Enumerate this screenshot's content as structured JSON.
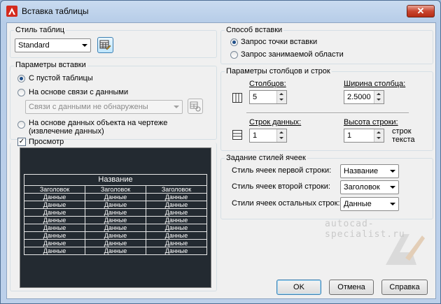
{
  "window": {
    "title": "Вставка таблицы",
    "close_glyph": "✕"
  },
  "table_style": {
    "title": "Стиль таблиц",
    "selected": "Standard"
  },
  "insert_params": {
    "title": "Параметры вставки",
    "opt_empty": "С пустой таблицы",
    "opt_data_link": "На основе связи с данными",
    "data_link_combo": "Связи с данными не обнаружены",
    "opt_object_data": "На основе данных объекта на чертеже (извлечение данных)"
  },
  "preview": {
    "label": "Просмотр",
    "checked": true,
    "title": "Название",
    "headers": [
      "Заголовок",
      "Заголовок",
      "Заголовок"
    ],
    "rows": [
      [
        "Данные",
        "Данные",
        "Данные"
      ],
      [
        "Данные",
        "Данные",
        "Данные"
      ],
      [
        "Данные",
        "Данные",
        "Данные"
      ],
      [
        "Данные",
        "Данные",
        "Данные"
      ],
      [
        "Данные",
        "Данные",
        "Данные"
      ],
      [
        "Данные",
        "Данные",
        "Данные"
      ],
      [
        "Данные",
        "Данные",
        "Данные"
      ],
      [
        "Данные",
        "Данные",
        "Данные"
      ]
    ]
  },
  "insert_method": {
    "title": "Способ вставки",
    "opt_point": "Запрос точки вставки",
    "opt_area": "Запрос занимаемой области"
  },
  "col_row_params": {
    "title": "Параметры столбцов и строк",
    "columns_label": "Столбцов:",
    "columns_value": "5",
    "col_width_label": "Ширина столбца:",
    "col_width_value": "2.5000",
    "data_rows_label": "Строк данных:",
    "data_rows_value": "1",
    "row_height_label": "Высота строки:",
    "row_height_value": "1",
    "row_height_unit": "строк текста"
  },
  "cell_styles": {
    "title": "Задание стилей ячеек",
    "first_row_label": "Стиль ячеек первой строки:",
    "first_row_value": "Название",
    "second_row_label": "Стиль ячеек второй строки:",
    "second_row_value": "Заголовок",
    "other_rows_label": "Стили ячеек остальных строк:",
    "other_rows_value": "Данные"
  },
  "buttons": {
    "ok": "OK",
    "cancel": "Отмена",
    "help": "Справка"
  },
  "watermark": "autocad-specialist.ru"
}
